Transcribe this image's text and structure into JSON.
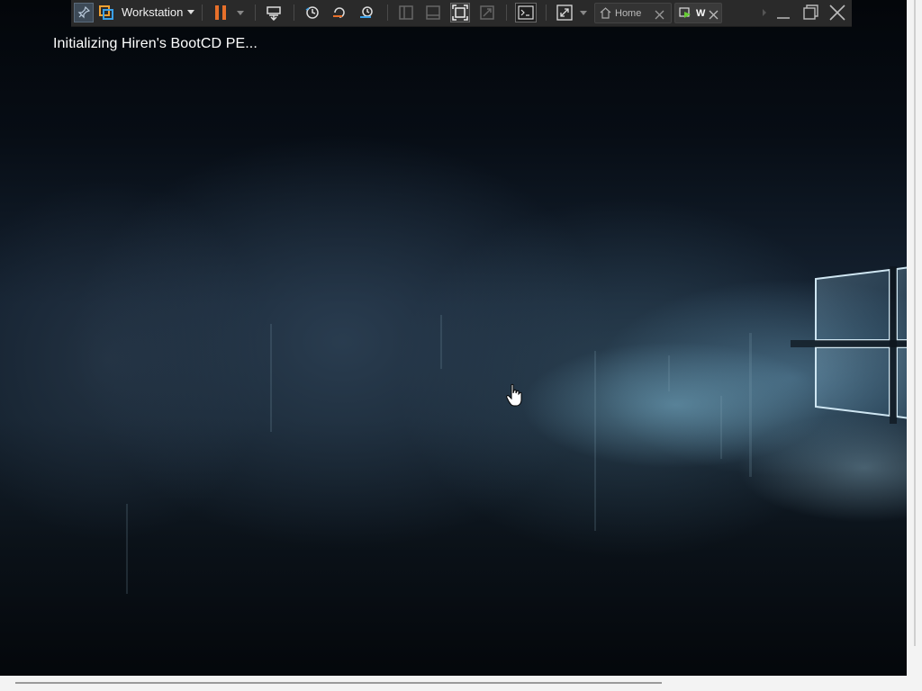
{
  "vm": {
    "boot_message": "Initializing Hiren's BootCD PE..."
  },
  "toolbar": {
    "app_menu_label": "Workstation",
    "home_tab_label": "Home",
    "vm_tab_label": "W"
  },
  "colors": {
    "toolbar_bg": "#2a2a2a",
    "pause_accent": "#e8702a",
    "icon_blue": "#3aa0e8",
    "logo_orange": "#f0a030"
  },
  "icons": [
    "pin-icon",
    "vmware-logo-icon",
    "dropdown-caret-icon",
    "pause-icon",
    "send-ctrl-alt-del-icon",
    "snapshot-icon",
    "revert-snapshot-icon",
    "snapshot-manager-icon",
    "library-view-icon",
    "thumbnail-bar-icon",
    "fit-guest-icon",
    "unity-icon",
    "console-view-icon",
    "fullscreen-icon",
    "home-icon",
    "close-icon",
    "vm-tab-icon",
    "tab-scroll-right-icon",
    "minimize-icon",
    "restore-icon",
    "window-close-icon",
    "hand-cursor-icon",
    "windows-logo-icon"
  ]
}
